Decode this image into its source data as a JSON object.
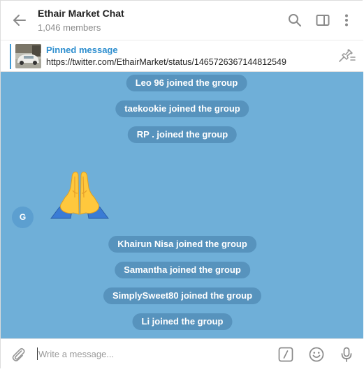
{
  "header": {
    "title": "Ethair Market Chat",
    "subtitle": "1,046 members",
    "icons": [
      "back-arrow-icon",
      "search-icon",
      "sidebar-toggle-icon",
      "more-vertical-icon"
    ]
  },
  "pinned": {
    "title": "Pinned message",
    "text": "https://twitter.com/EthairMarket/status/1465726367144812549"
  },
  "messages": {
    "service": [
      "Leo 96 joined the group",
      "taekookie joined the group",
      "RP . joined the group",
      "Khairun Nisa joined the group",
      "Samantha joined the group",
      "SimplySweet80 joined the group",
      "Li joined the group"
    ],
    "sticker": {
      "avatar_initial": "G",
      "emoji": "folded-hands"
    }
  },
  "compose": {
    "placeholder": "Write a message...",
    "icons": [
      "paperclip-icon",
      "slash-commands-icon",
      "emoji-icon",
      "microphone-icon"
    ]
  },
  "colors": {
    "chat_background": "#6fafd8",
    "service_bubble": "#5793bd",
    "accent": "#2f8fcf",
    "avatar": "#5c9fd0"
  }
}
